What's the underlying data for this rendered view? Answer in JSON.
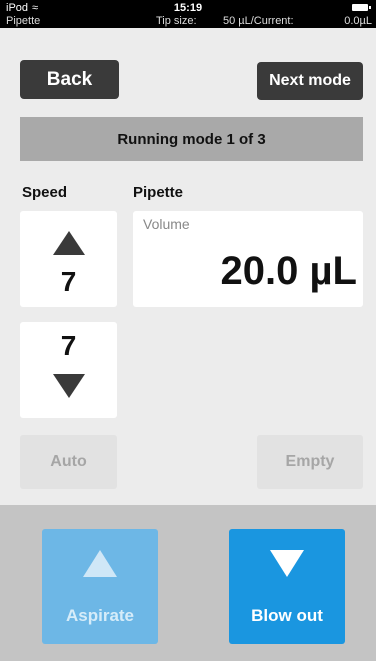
{
  "status_bar": {
    "carrier": "iPod",
    "time": "15:19",
    "mode": "Pipette",
    "tip_size_label": "Tip size:",
    "tip_size_value": "50 µL/Current:",
    "current_value": "0.0µL"
  },
  "nav": {
    "back_label": "Back",
    "next_label": "Next mode"
  },
  "banner": "Running mode 1 of 3",
  "speed": {
    "label": "Speed",
    "aspirate_speed": "7",
    "dispense_speed": "7"
  },
  "pipette": {
    "label": "Pipette",
    "volume_label": "Volume",
    "volume_value": "20.0 µL"
  },
  "buttons": {
    "auto": "Auto",
    "empty": "Empty",
    "aspirate": "Aspirate",
    "blow_out": "Blow out"
  },
  "colors": {
    "aspirate_disabled": "#6db7e6",
    "blow_out_active": "#1a96e0"
  }
}
